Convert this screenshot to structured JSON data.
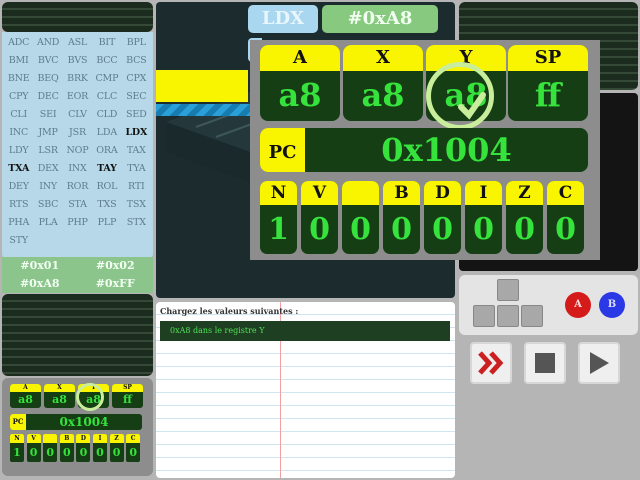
{
  "instructions": [
    "ADC",
    "AND",
    "ASL",
    "BIT",
    "BPL",
    "BMI",
    "BVC",
    "BVS",
    "BCC",
    "BCS",
    "BNE",
    "BEQ",
    "BRK",
    "CMP",
    "CPX",
    "CPY",
    "DEC",
    "EOR",
    "CLC",
    "SEC",
    "CLI",
    "SEI",
    "CLV",
    "CLD",
    "SED",
    "INC",
    "JMP",
    "JSR",
    "LDA",
    "LDX",
    "LDY",
    "LSR",
    "NOP",
    "ORA",
    "TAX",
    "TXA",
    "DEX",
    "INX",
    "TAY",
    "TYA",
    "DEY",
    "INY",
    "ROR",
    "ROL",
    "RTI",
    "RTS",
    "SBC",
    "STA",
    "TXS",
    "TSX",
    "PHA",
    "PLA",
    "PHP",
    "PLP",
    "STX",
    "STY"
  ],
  "highlighted": [
    "LDX",
    "TXA",
    "TAY"
  ],
  "operands": [
    "#0x01",
    "#0x02",
    "#0xA8",
    "#0xFF"
  ],
  "current": {
    "mnemonic": "LDX",
    "operand": "#0xA8"
  },
  "registers": {
    "main": [
      {
        "label": "A",
        "value": "a8"
      },
      {
        "label": "X",
        "value": "a8"
      },
      {
        "label": "Y",
        "value": "a8"
      },
      {
        "label": "SP",
        "value": "ff"
      }
    ],
    "pc": {
      "label": "PC",
      "value": "0x1004"
    },
    "flags": [
      {
        "label": "N",
        "value": "1"
      },
      {
        "label": "V",
        "value": "0"
      },
      {
        "label": "",
        "value": "0"
      },
      {
        "label": "B",
        "value": "0"
      },
      {
        "label": "D",
        "value": "0"
      },
      {
        "label": "I",
        "value": "0"
      },
      {
        "label": "Z",
        "value": "0"
      },
      {
        "label": "C",
        "value": "0"
      }
    ]
  },
  "notebook": {
    "title": "Chargez les valeurs suivantes :",
    "task": "0xA8 dans le registre Y"
  },
  "controls": {
    "button_a": "A",
    "button_b": "B"
  },
  "colors": {
    "register_bg": "#163e14",
    "label_bg": "#f9f400",
    "value_fg": "#36e23c"
  }
}
